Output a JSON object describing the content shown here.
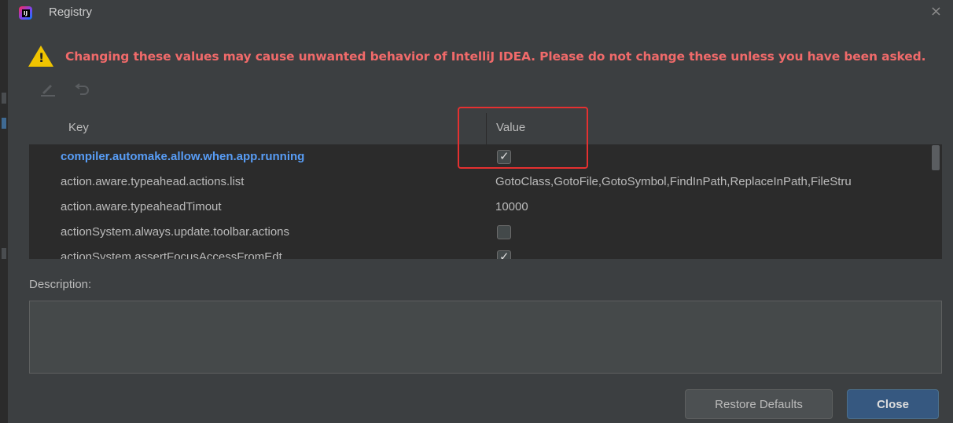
{
  "window": {
    "title": "Registry",
    "close_glyph": "×"
  },
  "warning": {
    "text": "Changing these values may cause unwanted behavior of IntelliJ IDEA. Please do not change these unless you have been asked.",
    "color": "#f06a6a",
    "icon": "warning-triangle-icon"
  },
  "toolbar": {
    "edit_icon": "edit-icon",
    "revert_icon": "revert-icon"
  },
  "table": {
    "headers": {
      "key": "Key",
      "value": "Value"
    },
    "rows": [
      {
        "key": "compiler.automake.allow.when.app.running",
        "value": "",
        "type": "checkbox",
        "checked": true,
        "selected": true
      },
      {
        "key": "action.aware.typeahead.actions.list",
        "value": "GotoClass,GotoFile,GotoSymbol,FindInPath,ReplaceInPath,FileStru",
        "type": "text"
      },
      {
        "key": "action.aware.typeaheadTimout",
        "value": "10000",
        "type": "text"
      },
      {
        "key": "actionSystem.always.update.toolbar.actions",
        "value": "",
        "type": "checkbox",
        "checked": false
      },
      {
        "key": "actionSystem.assertFocusAccessFromEdt",
        "value": "",
        "type": "checkbox",
        "checked": true
      }
    ]
  },
  "description": {
    "label": "Description:",
    "value": ""
  },
  "buttons": {
    "restore": "Restore Defaults",
    "close": "Close"
  },
  "colors": {
    "selected_key": "#589df6",
    "highlight_box": "#e53030",
    "primary_button": "#365880"
  }
}
